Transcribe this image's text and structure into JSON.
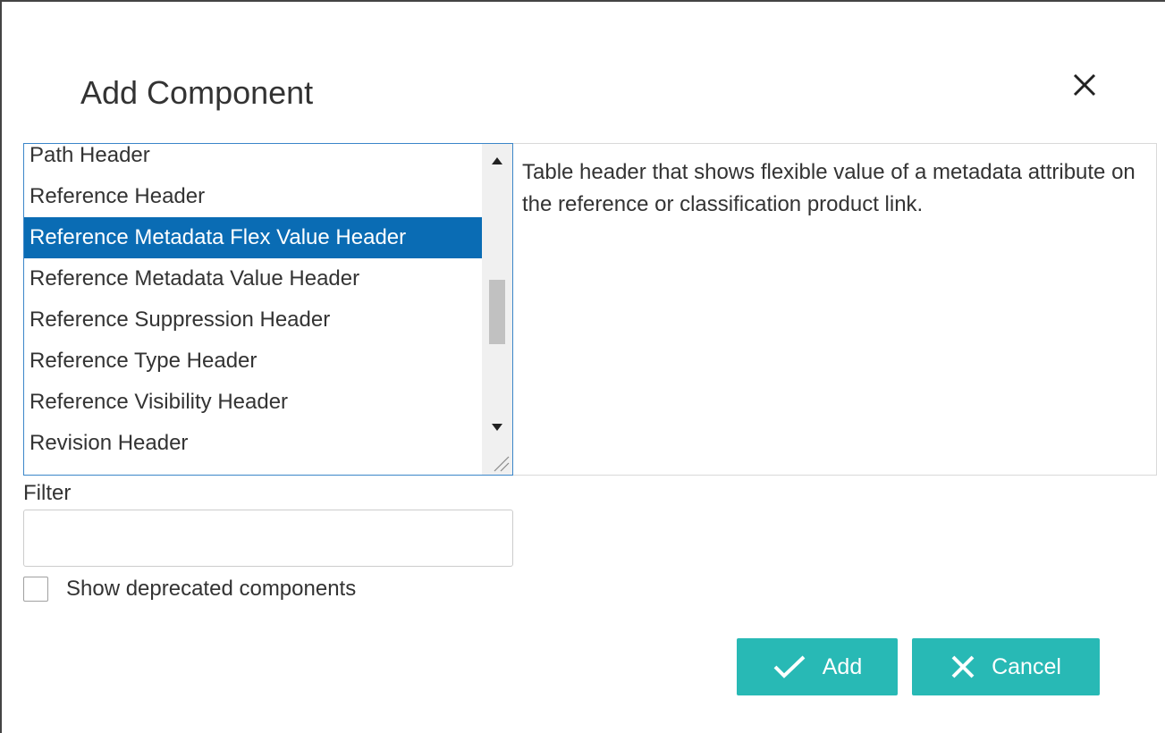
{
  "dialog": {
    "title": "Add Component"
  },
  "icons": {
    "close": "close-icon",
    "scroll_up": "triangle-up-icon",
    "scroll_down": "triangle-down-icon",
    "resize": "resize-grip-icon",
    "add": "checkmark-icon",
    "cancel": "x-icon"
  },
  "component_list": {
    "items": [
      {
        "label": "Path Header",
        "selected": false
      },
      {
        "label": "Reference Header",
        "selected": false
      },
      {
        "label": "Reference Metadata Flex Value Header",
        "selected": true
      },
      {
        "label": "Reference Metadata Value Header",
        "selected": false
      },
      {
        "label": "Reference Suppression Header",
        "selected": false
      },
      {
        "label": "Reference Type Header",
        "selected": false
      },
      {
        "label": "Reference Visibility Header",
        "selected": false
      },
      {
        "label": "Revision Header",
        "selected": false
      }
    ]
  },
  "description": "Table header that shows flexible value of a metadata attribute on the reference or classification product link.",
  "filter": {
    "label": "Filter",
    "value": "",
    "placeholder": ""
  },
  "show_deprecated": {
    "label": "Show deprecated components",
    "checked": false
  },
  "buttons": {
    "add_label": "Add",
    "cancel_label": "Cancel"
  },
  "colors": {
    "accent": "#28b9b5",
    "selection": "#0a6cb4",
    "list_border": "#3b86c9"
  }
}
